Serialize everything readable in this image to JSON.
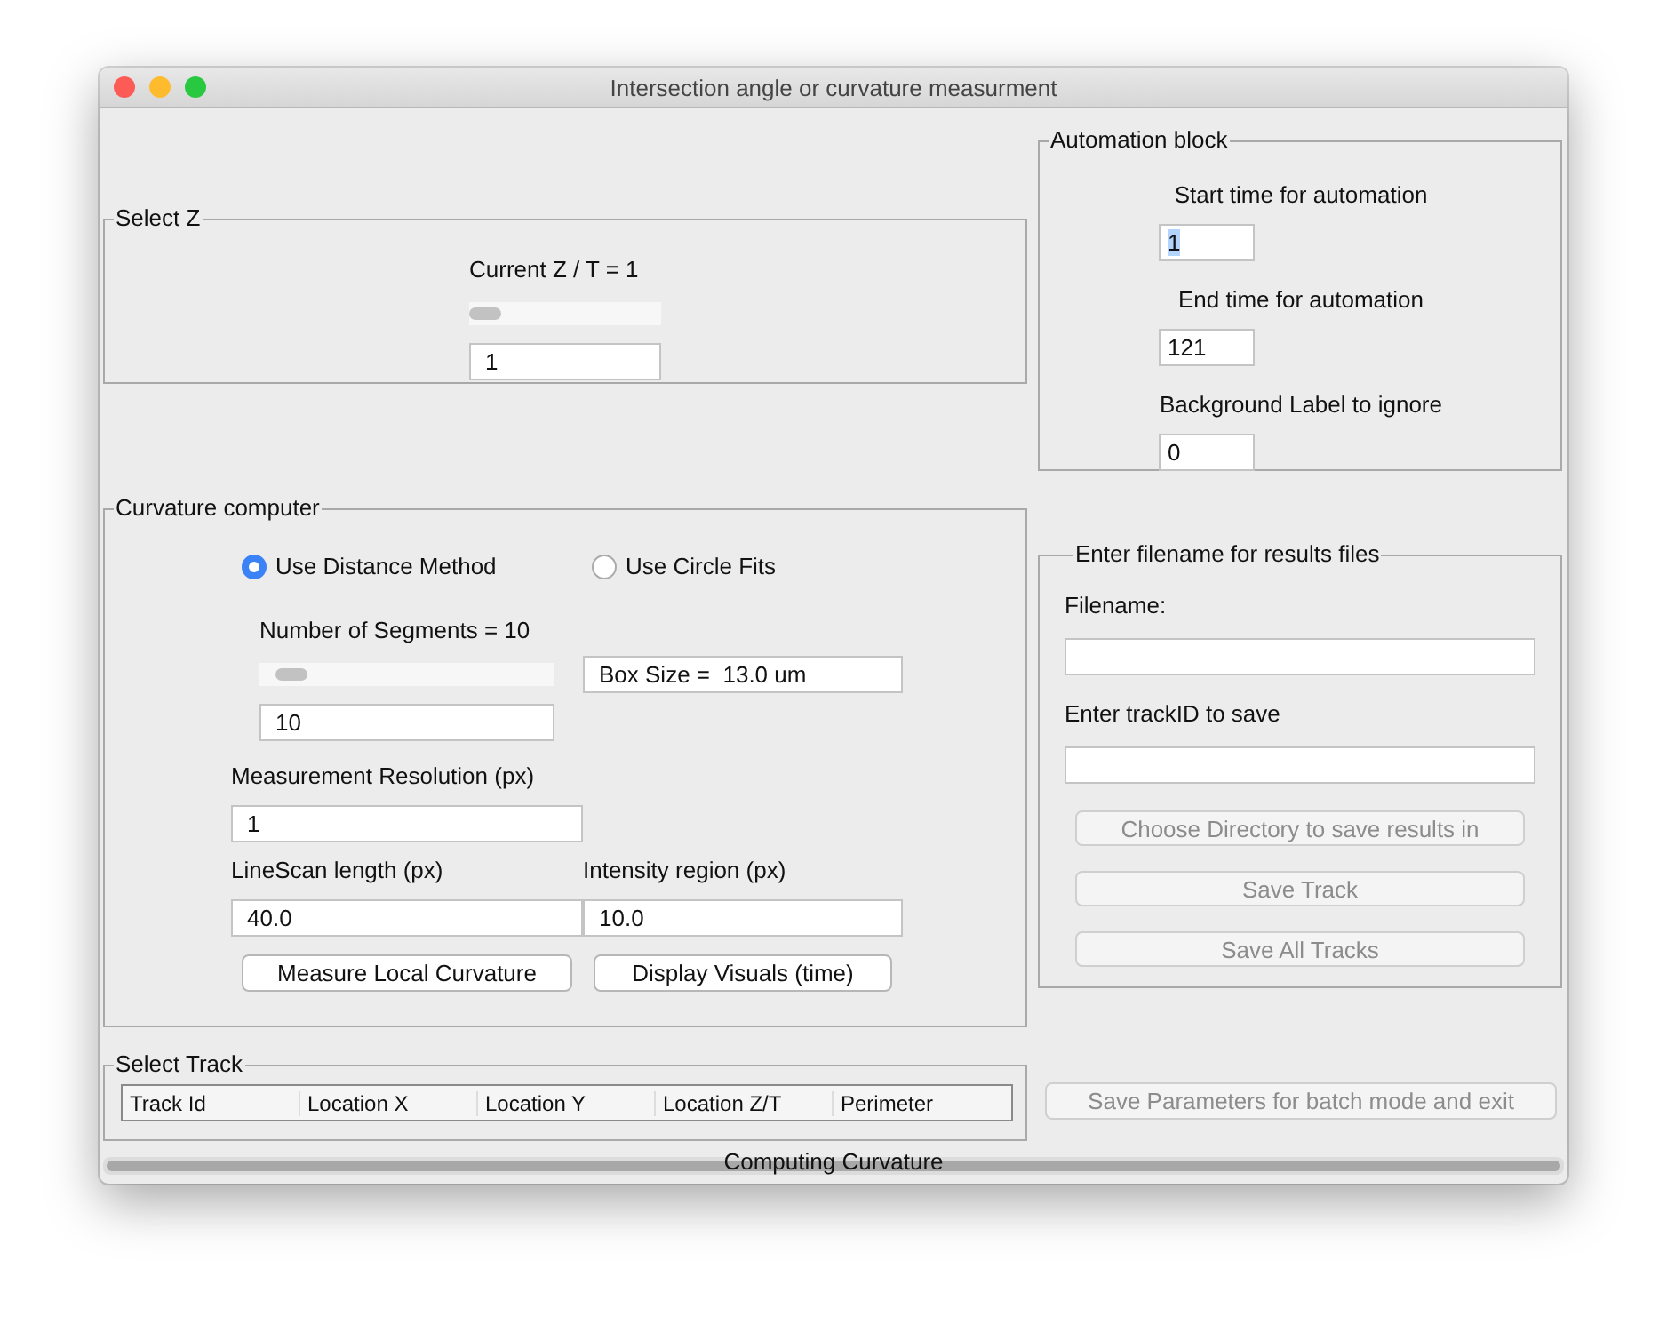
{
  "window": {
    "title": "Intersection angle or curvature measurment"
  },
  "select_z": {
    "title": "Select Z",
    "label": "Current Z / T = 1",
    "level": 0,
    "value": "1"
  },
  "curvature": {
    "title": "Curvature computer",
    "radios": [
      {
        "label": "Use Distance Method",
        "selected": true
      },
      {
        "label": "Use Circle Fits",
        "selected": false
      }
    ],
    "segments_label": "Number of Segments = 10",
    "segments_slider": {
      "level": 0.06
    },
    "segments_value": "10",
    "box_size": "Box Size =  13.0 um",
    "resolution_label": "Measurement Resolution (px)",
    "resolution_value": "1",
    "linescan_label": "LineScan length (px)",
    "linescan_value": "40.0",
    "intensity_label": "Intensity region (px)",
    "intensity_value": "10.0",
    "buttons": [
      {
        "label": "Measure Local Curvature",
        "disabled": false
      },
      {
        "label": "Display Visuals (time)",
        "disabled": false
      }
    ]
  },
  "select_track": {
    "title": "Select Track",
    "columns": [
      "Track Id",
      "Location X",
      "Location Y",
      "Location Z/T",
      "Perimeter"
    ]
  },
  "automation": {
    "title": "Automation block",
    "fields": [
      {
        "label": "Start time for automation",
        "value": "1",
        "highlighted": true
      },
      {
        "label": "End time for automation",
        "value": "121",
        "highlighted": false
      },
      {
        "label": "Background Label to ignore",
        "value": "0",
        "highlighted": false
      }
    ]
  },
  "results": {
    "title": "Enter filename for results files",
    "fields": [
      {
        "label": "Filename:"
      },
      {
        "label": "Enter trackID to save"
      }
    ],
    "buttons": [
      {
        "label": "Choose Directory to save results in",
        "disabled": true
      },
      {
        "label": "Save Track",
        "disabled": true
      },
      {
        "label": "Save All Tracks",
        "disabled": true
      }
    ]
  },
  "save_params": {
    "label": "Save Parameters for batch mode and exit",
    "disabled": true
  },
  "progress": {
    "label": "Computing Curvature",
    "level": 1
  }
}
